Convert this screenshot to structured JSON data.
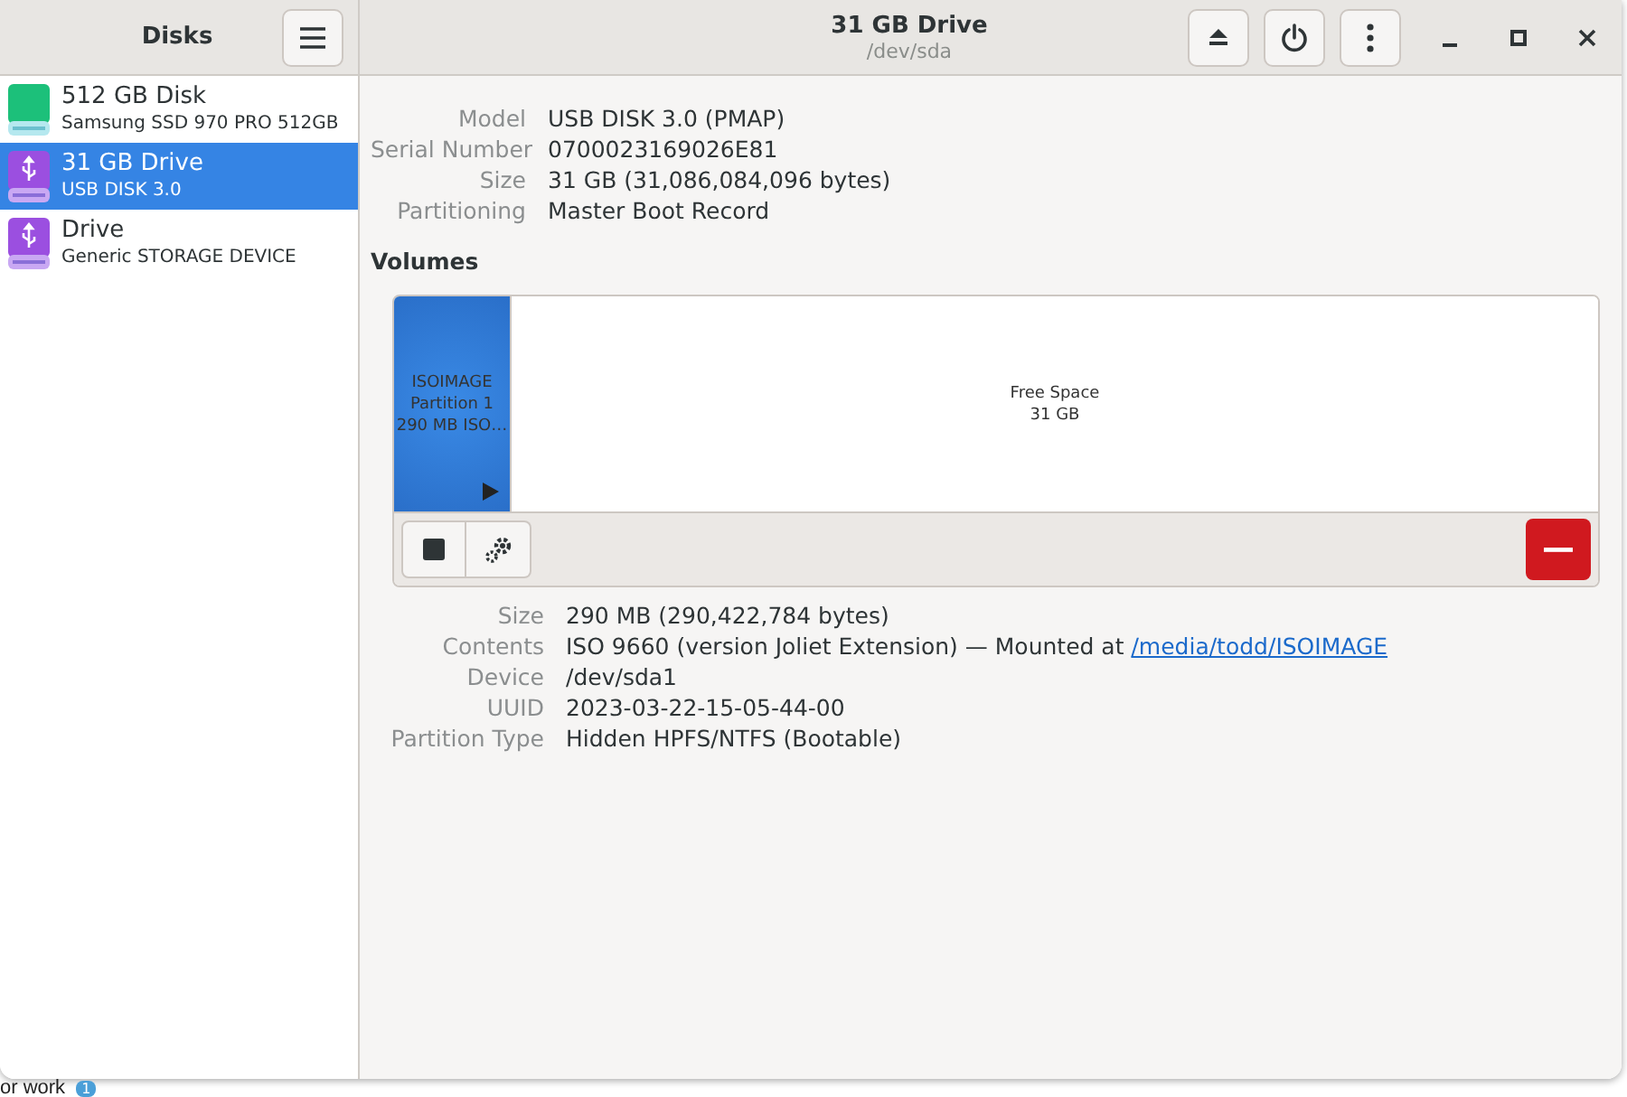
{
  "sidebar": {
    "title": "Disks",
    "items": [
      {
        "name": "512 GB Disk",
        "subtitle": "Samsung SSD 970 PRO 512GB",
        "kind": "ssd",
        "selected": false
      },
      {
        "name": "31 GB Drive",
        "subtitle": "USB DISK 3.0",
        "kind": "usb",
        "selected": true
      },
      {
        "name": "Drive",
        "subtitle": "Generic STORAGE DEVICE",
        "kind": "usb",
        "selected": false
      }
    ]
  },
  "header": {
    "title": "31 GB Drive",
    "subtitle": "/dev/sda"
  },
  "drive_properties": [
    {
      "label": "Model",
      "value": "USB DISK 3.0 (PMAP)"
    },
    {
      "label": "Serial Number",
      "value": "0700023169026E81"
    },
    {
      "label": "Size",
      "value": "31 GB (31,086,084,096 bytes)"
    },
    {
      "label": "Partitioning",
      "value": "Master Boot Record"
    }
  ],
  "volumes": {
    "heading": "Volumes",
    "segments": [
      {
        "kind": "partition",
        "lines": [
          "ISOIMAGE",
          "Partition 1",
          "290 MB ISO…"
        ],
        "selected": true,
        "mounted": true
      },
      {
        "kind": "free",
        "lines": [
          "Free Space",
          "31 GB"
        ],
        "selected": false,
        "mounted": false
      }
    ]
  },
  "volume_properties": [
    {
      "label": "Size",
      "value": "290 MB (290,422,784 bytes)"
    },
    {
      "label": "Contents",
      "value": "ISO 9660 (version Joliet Extension) — Mounted at ",
      "link": "/media/todd/ISOIMAGE"
    },
    {
      "label": "Device",
      "value": "/dev/sda1"
    },
    {
      "label": "UUID",
      "value": "2023-03-22-15-05-44-00"
    },
    {
      "label": "Partition Type",
      "value": "Hidden HPFS/NTFS (Bootable)"
    }
  ],
  "desktop": {
    "text": "or work",
    "badge": "1"
  }
}
